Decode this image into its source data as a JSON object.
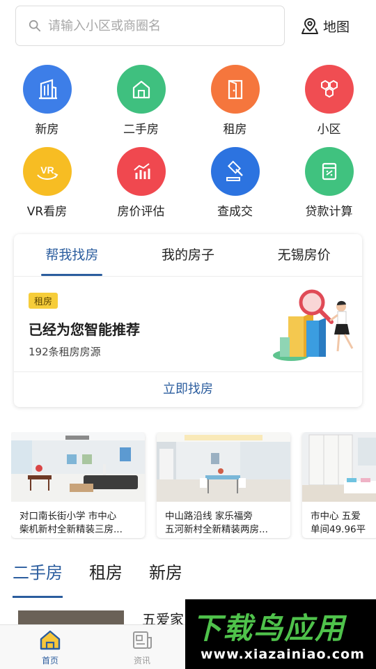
{
  "search": {
    "placeholder": "请输入小区或商圈名"
  },
  "map_button": {
    "label": "地图"
  },
  "grid": [
    [
      {
        "label": "新房",
        "icon": "building-icon",
        "color": "#3d7ee8"
      },
      {
        "label": "二手房",
        "icon": "house-icon",
        "color": "#3fc07f"
      },
      {
        "label": "租房",
        "icon": "door-icon",
        "color": "#f5763d"
      },
      {
        "label": "小区",
        "icon": "hexagons-icon",
        "color": "#f04d52"
      }
    ],
    [
      {
        "label": "VR看房",
        "icon": "vr-icon",
        "color": "#f7bd23"
      },
      {
        "label": "房价评估",
        "icon": "bar-chart-icon",
        "color": "#f0484f"
      },
      {
        "label": "查成交",
        "icon": "gavel-icon",
        "color": "#2c73e0"
      },
      {
        "label": "贷款计算",
        "icon": "calculator-icon",
        "color": "#40c27f"
      }
    ]
  ],
  "card": {
    "tabs": [
      "帮我找房",
      "我的房子",
      "无锡房价"
    ],
    "tag": "租房",
    "title": "已经为您智能推荐",
    "subtitle": "192条租房房源",
    "action": "立即找房"
  },
  "listings": [
    {
      "line1": "对口南长街小学 市中心",
      "line2": "柴机新村全新精装三房..."
    },
    {
      "line1": "中山路沿线 家乐福旁",
      "line2": "五河新村全新精装两房..."
    },
    {
      "line1": "市中心 五爱",
      "line2": "单间49.96平"
    }
  ],
  "category_tabs": [
    "二手房",
    "租房",
    "新房"
  ],
  "list_item_title": "五爱家",
  "bottom_nav": [
    {
      "label": "首页",
      "icon": "home-icon"
    },
    {
      "label": "资讯",
      "icon": "news-icon"
    }
  ],
  "watermark": {
    "title": "下载鸟应用",
    "url": "www.xiazainiao.com"
  },
  "colors": {
    "accent": "#2b5d9e",
    "tag_yellow": "#f6cd3a"
  }
}
